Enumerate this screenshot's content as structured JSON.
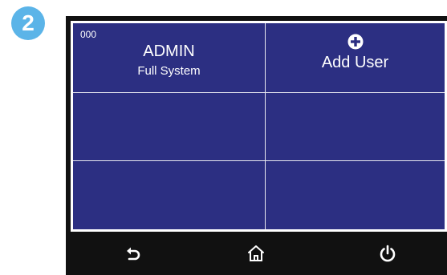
{
  "step_badge": "2",
  "users": [
    {
      "id": "000",
      "name": "ADMIN",
      "role": "Full System"
    }
  ],
  "add_user": {
    "icon": "plus-circle-icon",
    "label": "Add User"
  },
  "navbar": {
    "back_icon": "back-arrow-icon",
    "home_icon": "home-icon",
    "power_icon": "power-icon"
  },
  "colors": {
    "tile": "#2c2f82",
    "grid_line": "#e8e8f0",
    "bezel": "#111111",
    "badge": "#5bb4e8"
  }
}
